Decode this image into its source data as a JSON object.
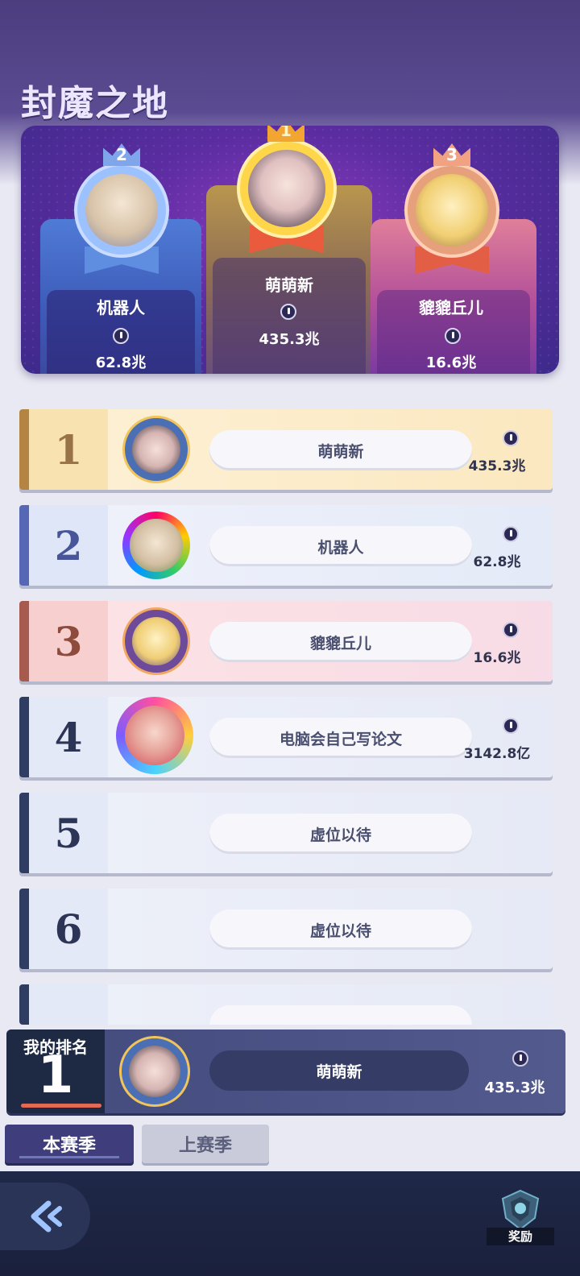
{
  "page_title": "封魔之地",
  "podium": {
    "first": {
      "rank": "1",
      "name": "萌萌新",
      "score": "435.3兆"
    },
    "second": {
      "rank": "2",
      "name": "机器人",
      "score": "62.8兆"
    },
    "third": {
      "rank": "3",
      "name": "貔貔丘儿",
      "score": "16.6兆"
    }
  },
  "rankings": [
    {
      "rank": "1",
      "name": "萌萌新",
      "score": "435.3兆"
    },
    {
      "rank": "2",
      "name": "机器人",
      "score": "62.8兆"
    },
    {
      "rank": "3",
      "name": "貔貔丘儿",
      "score": "16.6兆"
    },
    {
      "rank": "4",
      "name": "电脑会自己写论文",
      "score": "3142.8亿"
    },
    {
      "rank": "5",
      "name": "虚位以待"
    },
    {
      "rank": "6",
      "name": "虚位以待"
    },
    {
      "rank": "7",
      "name": ""
    }
  ],
  "my_rank": {
    "label": "我的排名",
    "rank": "1",
    "name": "萌萌新",
    "score": "435.3兆"
  },
  "tabs": [
    {
      "label": "本赛季",
      "active": true
    },
    {
      "label": "上赛季",
      "active": false
    }
  ],
  "nav": {
    "reward_label": "奖励"
  },
  "icons": {
    "back": "back-chevron-icon",
    "reward": "shield-trophy-icon",
    "score": "coin-icon"
  }
}
